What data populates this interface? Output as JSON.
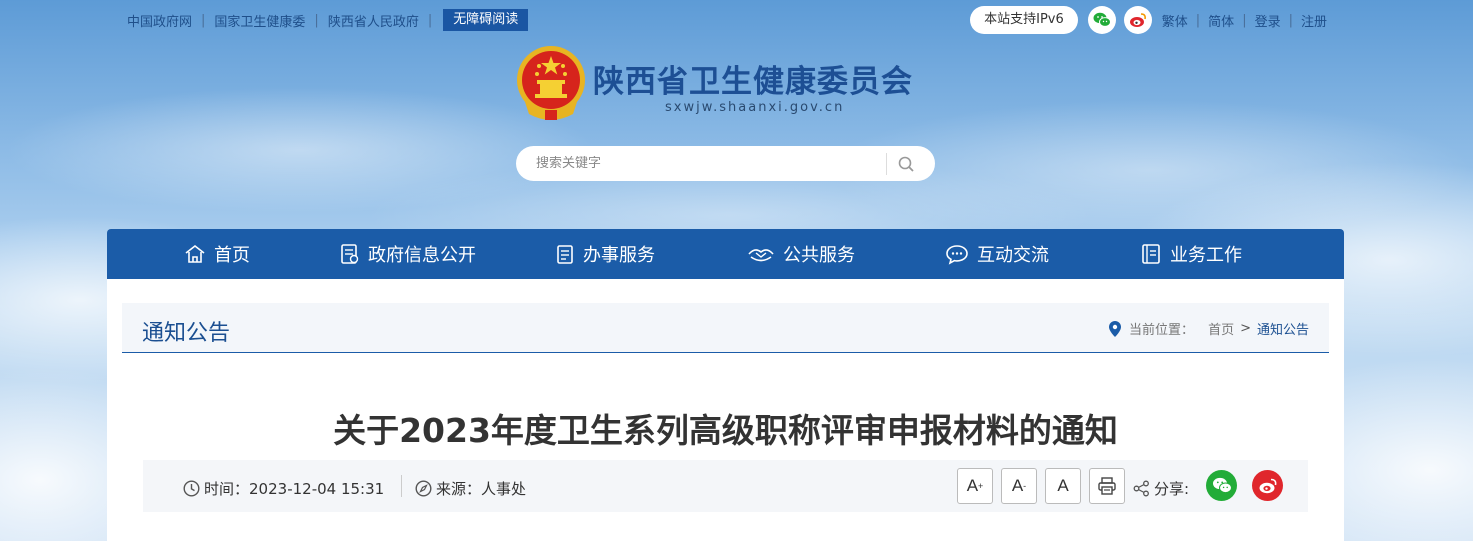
{
  "top_links": [
    "中国政府网",
    "国家卫生健康委",
    "陕西省人民政府"
  ],
  "accessibility_button": "无障碍阅读",
  "ipv6_label": "本站支持IPv6",
  "lang_links": [
    "繁体",
    "简体"
  ],
  "account_links": [
    "登录",
    "注册"
  ],
  "site": {
    "title": "陕西省卫生健康委员会",
    "domain": "sxwjw.shaanxi.gov.cn"
  },
  "search": {
    "placeholder": "搜索关键字"
  },
  "nav": [
    {
      "label": "首页",
      "icon": "home-icon"
    },
    {
      "label": "政府信息公开",
      "icon": "document-icon"
    },
    {
      "label": "办事服务",
      "icon": "clipboard-icon"
    },
    {
      "label": "公共服务",
      "icon": "handshake-icon"
    },
    {
      "label": "互动交流",
      "icon": "chat-icon"
    },
    {
      "label": "业务工作",
      "icon": "book-icon"
    }
  ],
  "column_title": "通知公告",
  "breadcrumb": {
    "prefix": "当前位置：",
    "home": "首页",
    "separator": ">",
    "current": "通知公告"
  },
  "article": {
    "title": "关于2023年度卫生系列高级职称评审申报材料的通知",
    "time_label": "时间：",
    "time_value": "2023-12-04 15:31",
    "source_label": "来源：",
    "source_value": "人事处"
  },
  "font_buttons": {
    "larger": "A",
    "larger_mark": "+",
    "smaller": "A",
    "smaller_mark": "-",
    "normal": "A"
  },
  "share_label": "分享:",
  "colors": {
    "nav_bg": "#1b5ca8",
    "accent": "#1d4f94",
    "wechat": "#22ac38",
    "weibo": "#e0262c"
  }
}
